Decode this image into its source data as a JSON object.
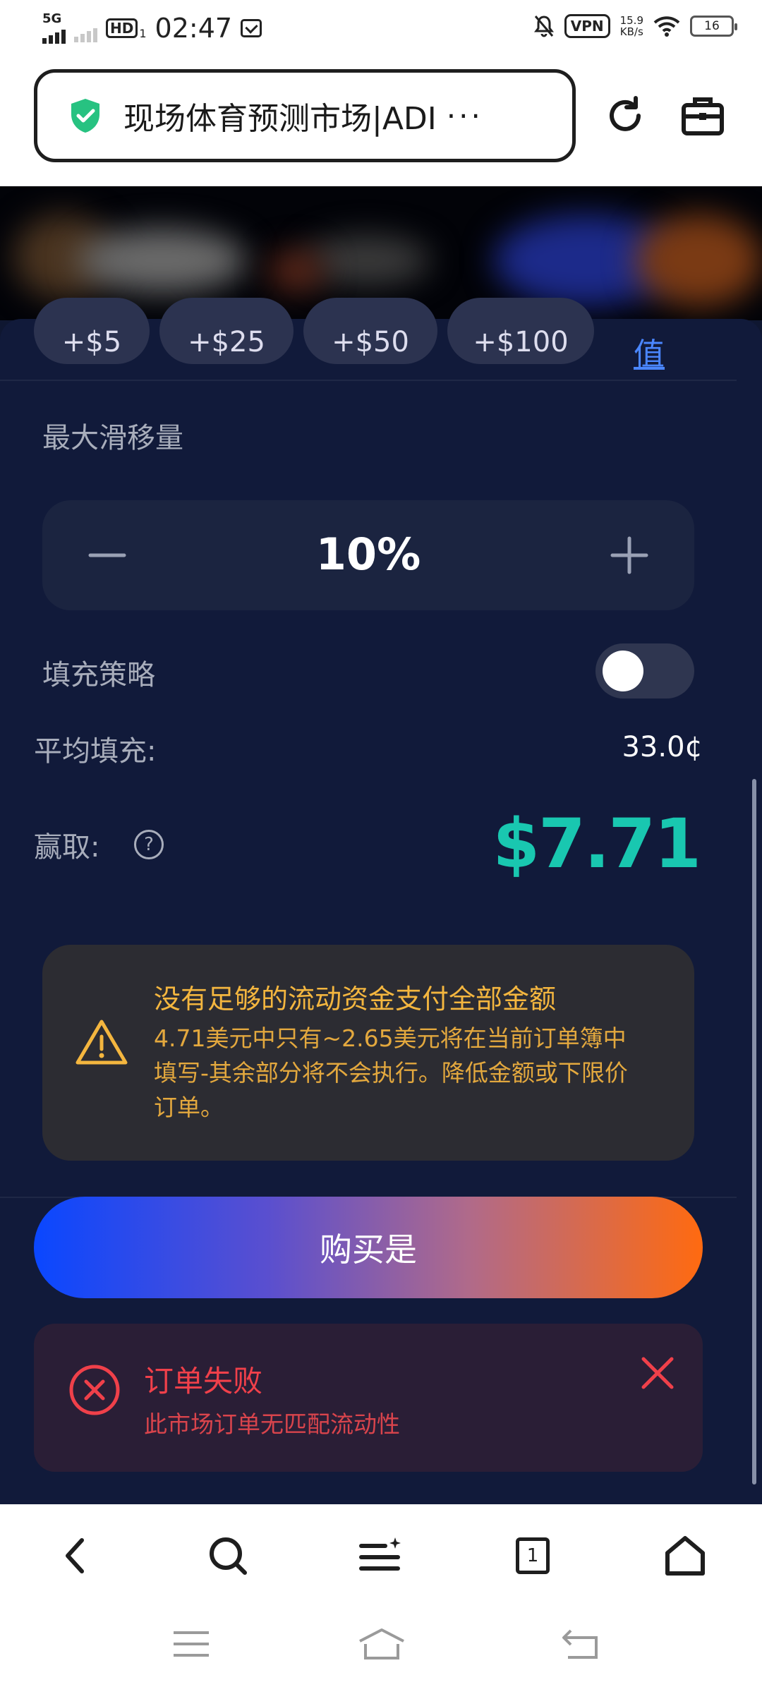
{
  "status_bar": {
    "network": "5G",
    "hd": "HD",
    "hd_sub": "1",
    "time": "02:47",
    "vpn": "VPN",
    "speed_value": "15.9",
    "speed_unit": "KB/s",
    "battery": "16"
  },
  "browser": {
    "address_title": "现场体育预测市场|ADI",
    "more": "···"
  },
  "amount_chips": [
    "+$5",
    "+$25",
    "+$50",
    "+$100"
  ],
  "max_link": "值",
  "slippage": {
    "label": "最大滑移量",
    "value": "10%",
    "minus": "−",
    "plus": "+"
  },
  "fill_strategy": {
    "label": "填充策略",
    "enabled": false
  },
  "average_fill": {
    "label": "平均填充:",
    "value": "33.0¢"
  },
  "win": {
    "label": "赢取:",
    "help": "?",
    "value": "$7.71"
  },
  "warning": {
    "title": "没有足够的流动资金支付全部金额",
    "body": "4.71美元中只有~2.65美元将在当前订单簿中填写-其余部分将不会执行。降低金额或下限价订单。"
  },
  "buy_button": "购买是",
  "error": {
    "title": "订单失败",
    "message": "此市场订单无匹配流动性"
  },
  "tab_count": "1",
  "colors": {
    "accent_green": "#19c7b0",
    "warning": "#f4b63f",
    "error": "#f0404a",
    "link": "#4a86ff",
    "background": "#111a3a"
  }
}
